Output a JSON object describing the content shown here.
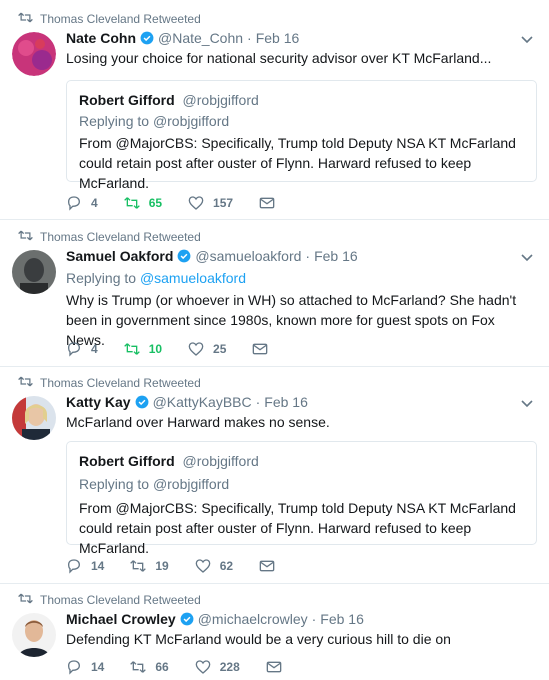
{
  "tweets": [
    {
      "retweeter": "Thomas Cleveland Retweeted",
      "name": "Nate Cohn",
      "verified": true,
      "handle": "@Nate_Cohn",
      "time": "Feb 16",
      "text": "Losing your choice for national security advisor over KT McFarland...",
      "quote": {
        "name": "Robert Gifford",
        "handle": "@robjgifford",
        "reply_prefix": "Replying to ",
        "reply_handle": "@robjgifford",
        "text": "From @MajorCBS: Specifically, Trump told Deputy NSA KT McFarland could retain post after ouster of Flynn. Harward refused to keep McFarland."
      },
      "replies": "4",
      "retweets": "65",
      "likes": "157"
    },
    {
      "retweeter": "Thomas Cleveland Retweeted",
      "name": "Samuel Oakford",
      "verified": true,
      "handle": "@samueloakford",
      "time": "Feb 16",
      "reply_prefix": "Replying to ",
      "reply_handle": "@samueloakford",
      "text": "Why is Trump (or whoever in WH) so attached to McFarland? She hadn't been in government since 1980s, known more for guest spots on Fox News.",
      "replies": "4",
      "retweets": "10",
      "likes": "25"
    },
    {
      "retweeter": "Thomas Cleveland Retweeted",
      "name": "Katty Kay",
      "verified": true,
      "handle": "@KattyKayBBC",
      "time": "Feb 16",
      "text": "McFarland over Harward makes no sense.",
      "quote": {
        "name": "Robert Gifford",
        "handle": "@robjgifford",
        "reply_prefix": "Replying to ",
        "reply_handle": "@robjgifford",
        "text": "From @MajorCBS: Specifically, Trump told Deputy NSA KT McFarland could retain post after ouster of Flynn. Harward refused to keep McFarland."
      },
      "replies": "14",
      "retweets": "19",
      "likes": "62"
    },
    {
      "retweeter": "Thomas Cleveland Retweeted",
      "name": "Michael Crowley",
      "verified": true,
      "handle": "@michaelcrowley",
      "time": "Feb 16",
      "text": "Defending KT McFarland would be a very curious hill to die on",
      "replies": "14",
      "retweets": "66",
      "likes": "228"
    }
  ],
  "icons": {
    "retweet": "retweet-icon",
    "reply": "reply-icon",
    "like": "heart-icon",
    "dm": "envelope-icon",
    "verified": "verified-badge-icon",
    "more": "chevron-down-icon"
  },
  "colors": {
    "accent": "#1da1f2",
    "retweet_green": "#17bf63",
    "muted": "#657786",
    "text": "#14171a",
    "border": "#e6ecf0"
  }
}
